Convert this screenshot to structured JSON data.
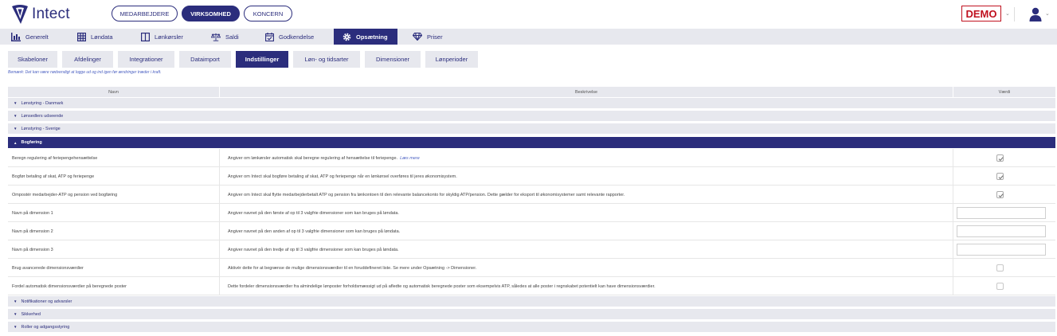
{
  "header": {
    "logo_text": "Intect",
    "scopes": [
      {
        "label": "MEDARBEJDERE",
        "active": false
      },
      {
        "label": "VIRKSOMHED",
        "active": true
      },
      {
        "label": "KONCERN",
        "active": false
      }
    ],
    "demo_label": "DEMO"
  },
  "main_nav": [
    {
      "label": "Generelt",
      "icon": "bar-chart-icon"
    },
    {
      "label": "Løndata",
      "icon": "table-grid-icon"
    },
    {
      "label": "Lønkørsler",
      "icon": "columns-icon"
    },
    {
      "label": "Saldi",
      "icon": "scale-icon"
    },
    {
      "label": "Godkendelse",
      "icon": "calendar-check-icon"
    },
    {
      "label": "Opsætning",
      "icon": "gear-icon",
      "active": true
    },
    {
      "label": "Priser",
      "icon": "diamond-icon"
    }
  ],
  "sub_tabs": [
    {
      "label": "Skabeloner"
    },
    {
      "label": "Afdelinger"
    },
    {
      "label": "Integrationer"
    },
    {
      "label": "Dataimport"
    },
    {
      "label": "Indstillinger",
      "active": true
    },
    {
      "label": "Løn- og tidsarter"
    },
    {
      "label": "Dimensioner"
    },
    {
      "label": "Lønperioder"
    }
  ],
  "note": "Bemærk: Det kan være nødvendigt at logge ud og ind igen før ændringer træder i kraft.",
  "table": {
    "columns": [
      "Navn",
      "Beskrivelse",
      "Værdi"
    ],
    "groups_before": [
      {
        "label": "Lønstyring - Danmark"
      },
      {
        "label": "Lønsedlers udseende"
      },
      {
        "label": "Lønstyring - Sverige"
      }
    ],
    "open_group": {
      "label": "Bogføring"
    },
    "rows": [
      {
        "name": "Beregn regulering af feriepengehensættelse",
        "desc": "Angiver om lønkørsler automatisk skal beregne regulering af hensættelse til feriepenge.",
        "link": "Læs mere",
        "type": "checkbox",
        "checked": true
      },
      {
        "name": "Bogfør betaling af skat, ATP og feriepenge",
        "desc": "Angiver om Intect skal bogføre betaling af skat, ATP og feriepenge når en lønkørsel overføres til jeres økonomisystem.",
        "type": "checkbox",
        "checked": true
      },
      {
        "name": "Ompostér medarbejder-ATP og pension ved bogføring",
        "desc": "Angiver om Intect skal flytte medarbejderbetalt ATP og pension fra lønkontoen til den relevante balancekonto for skyldig ATP/pension. Dette gælder for eksport til økonomisystemer samt relevante rapporter.",
        "type": "checkbox",
        "checked": true
      },
      {
        "name": "Navn på dimension 1",
        "desc": "Angiver navnet på den første af op til 3 valgfrie dimensioner som kan bruges på løndata.",
        "type": "text",
        "value": ""
      },
      {
        "name": "Navn på dimension 2",
        "desc": "Angiver navnet på den anden af op til 3 valgfrie dimensioner som kan bruges på løndata.",
        "type": "text",
        "value": ""
      },
      {
        "name": "Navn på dimension 3",
        "desc": "Angiver navnet på den tredje af op til 3 valgfrie dimensioner som kan bruges på løndata.",
        "type": "text",
        "value": ""
      },
      {
        "name": "Brug avancerede dimensionsværdier",
        "desc": "Aktivér dette for at begrænse de mulige dimensionsværdier til en foruddefineret liste. Se mere under Opsætning -> Dimensioner.",
        "type": "checkbox",
        "checked": false
      },
      {
        "name": "Fordel automatisk dimensionsværdier på beregnede poster",
        "desc": "Dette fordeler dimensionsværdier fra almindelige lønposter forholdsmæssigt ud på afledte og automatisk beregnede poster som eksempelvis ATP, således at alle poster i regnskabet potentielt kan have dimensionsværdier.",
        "type": "checkbox",
        "checked": false
      }
    ],
    "groups_after": [
      {
        "label": "Notifikationer og advarsler"
      },
      {
        "label": "Sikkerhed"
      },
      {
        "label": "Roller og adgangsstyring"
      }
    ]
  },
  "colors": {
    "brand": "#2b2d7c",
    "demo": "#c0111f",
    "nav_bg": "#e7e8ee"
  }
}
